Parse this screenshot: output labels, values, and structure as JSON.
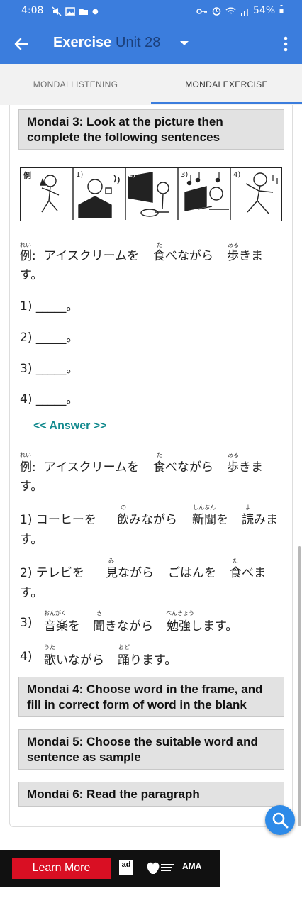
{
  "status": {
    "time": "4:08",
    "battery": "54%"
  },
  "appbar": {
    "title": "Exercise",
    "unit": "Unit 28"
  },
  "tabs": [
    {
      "label": "MONDAI LISTENING"
    },
    {
      "label": "MONDAI EXERCISE"
    }
  ],
  "mondai3": {
    "header": "Mondai 3: Look at the picture then complete the following sentences",
    "picture_labels": [
      "例",
      "1)",
      "2)",
      "3)",
      "4)"
    ],
    "example": {
      "rei": "例:",
      "rei_ruby": "れい",
      "part1": "アイスクリームを",
      "ta_ruby": "た",
      "tabe": "食べながら",
      "aru_ruby": "ある",
      "aruki": "歩きま",
      "end": "す。"
    },
    "blanks": [
      "1) _____。",
      "2) _____。",
      "3) _____。",
      "4) _____。"
    ],
    "answer_link": "<< Answer >>",
    "answers": {
      "a1": {
        "text": "1) コーヒーを",
        "no_ruby": "の",
        "nomi": "飲みながら",
        "shinbun_ruby": "しんぶん",
        "shinbun": "新聞を",
        "yo_ruby": "よ",
        "yomi": "読みま",
        "end": "す。"
      },
      "a2": {
        "text": "2) テレビを",
        "mi_ruby": "み",
        "mi": "見ながら",
        "gohan": "ごはんを",
        "ta_ruby": "た",
        "tabe": "食べま",
        "end": "す。"
      },
      "a3": {
        "prefix": "3)",
        "ongaku_ruby": "おんがく",
        "ongaku": "音楽を",
        "ki_ruby": "き",
        "kiki": "聞きながら",
        "benkyou_ruby": "べんきょう",
        "benkyou": "勉強します。"
      },
      "a4": {
        "prefix": "4)",
        "uta_ruby": "うた",
        "uta": "歌いながら",
        "odo_ruby": "おど",
        "odori": "踊ります。"
      }
    }
  },
  "mondai4": {
    "header": "Mondai 4: Choose word in the frame, and fill in correct form of word in the blank"
  },
  "mondai5": {
    "header": "Mondai 5: Choose the suitable word and sentence as sample"
  },
  "mondai6": {
    "header": "Mondai 6: Read the paragraph"
  },
  "ad": {
    "button": "Learn More",
    "logo1": "ad",
    "aha_text": "American Heart Association",
    "ama_text": "AMA"
  },
  "colors": {
    "primary": "#3b7ddd",
    "unit_text": "#1b3f7a",
    "answer_link": "#138a8e",
    "fab": "#2d8ae8",
    "ad_red": "#d90f23"
  },
  "icons": {
    "back": "arrow-left-icon",
    "dropdown": "caret-down-icon",
    "menu": "more-vert-icon",
    "fab": "search-icon"
  }
}
